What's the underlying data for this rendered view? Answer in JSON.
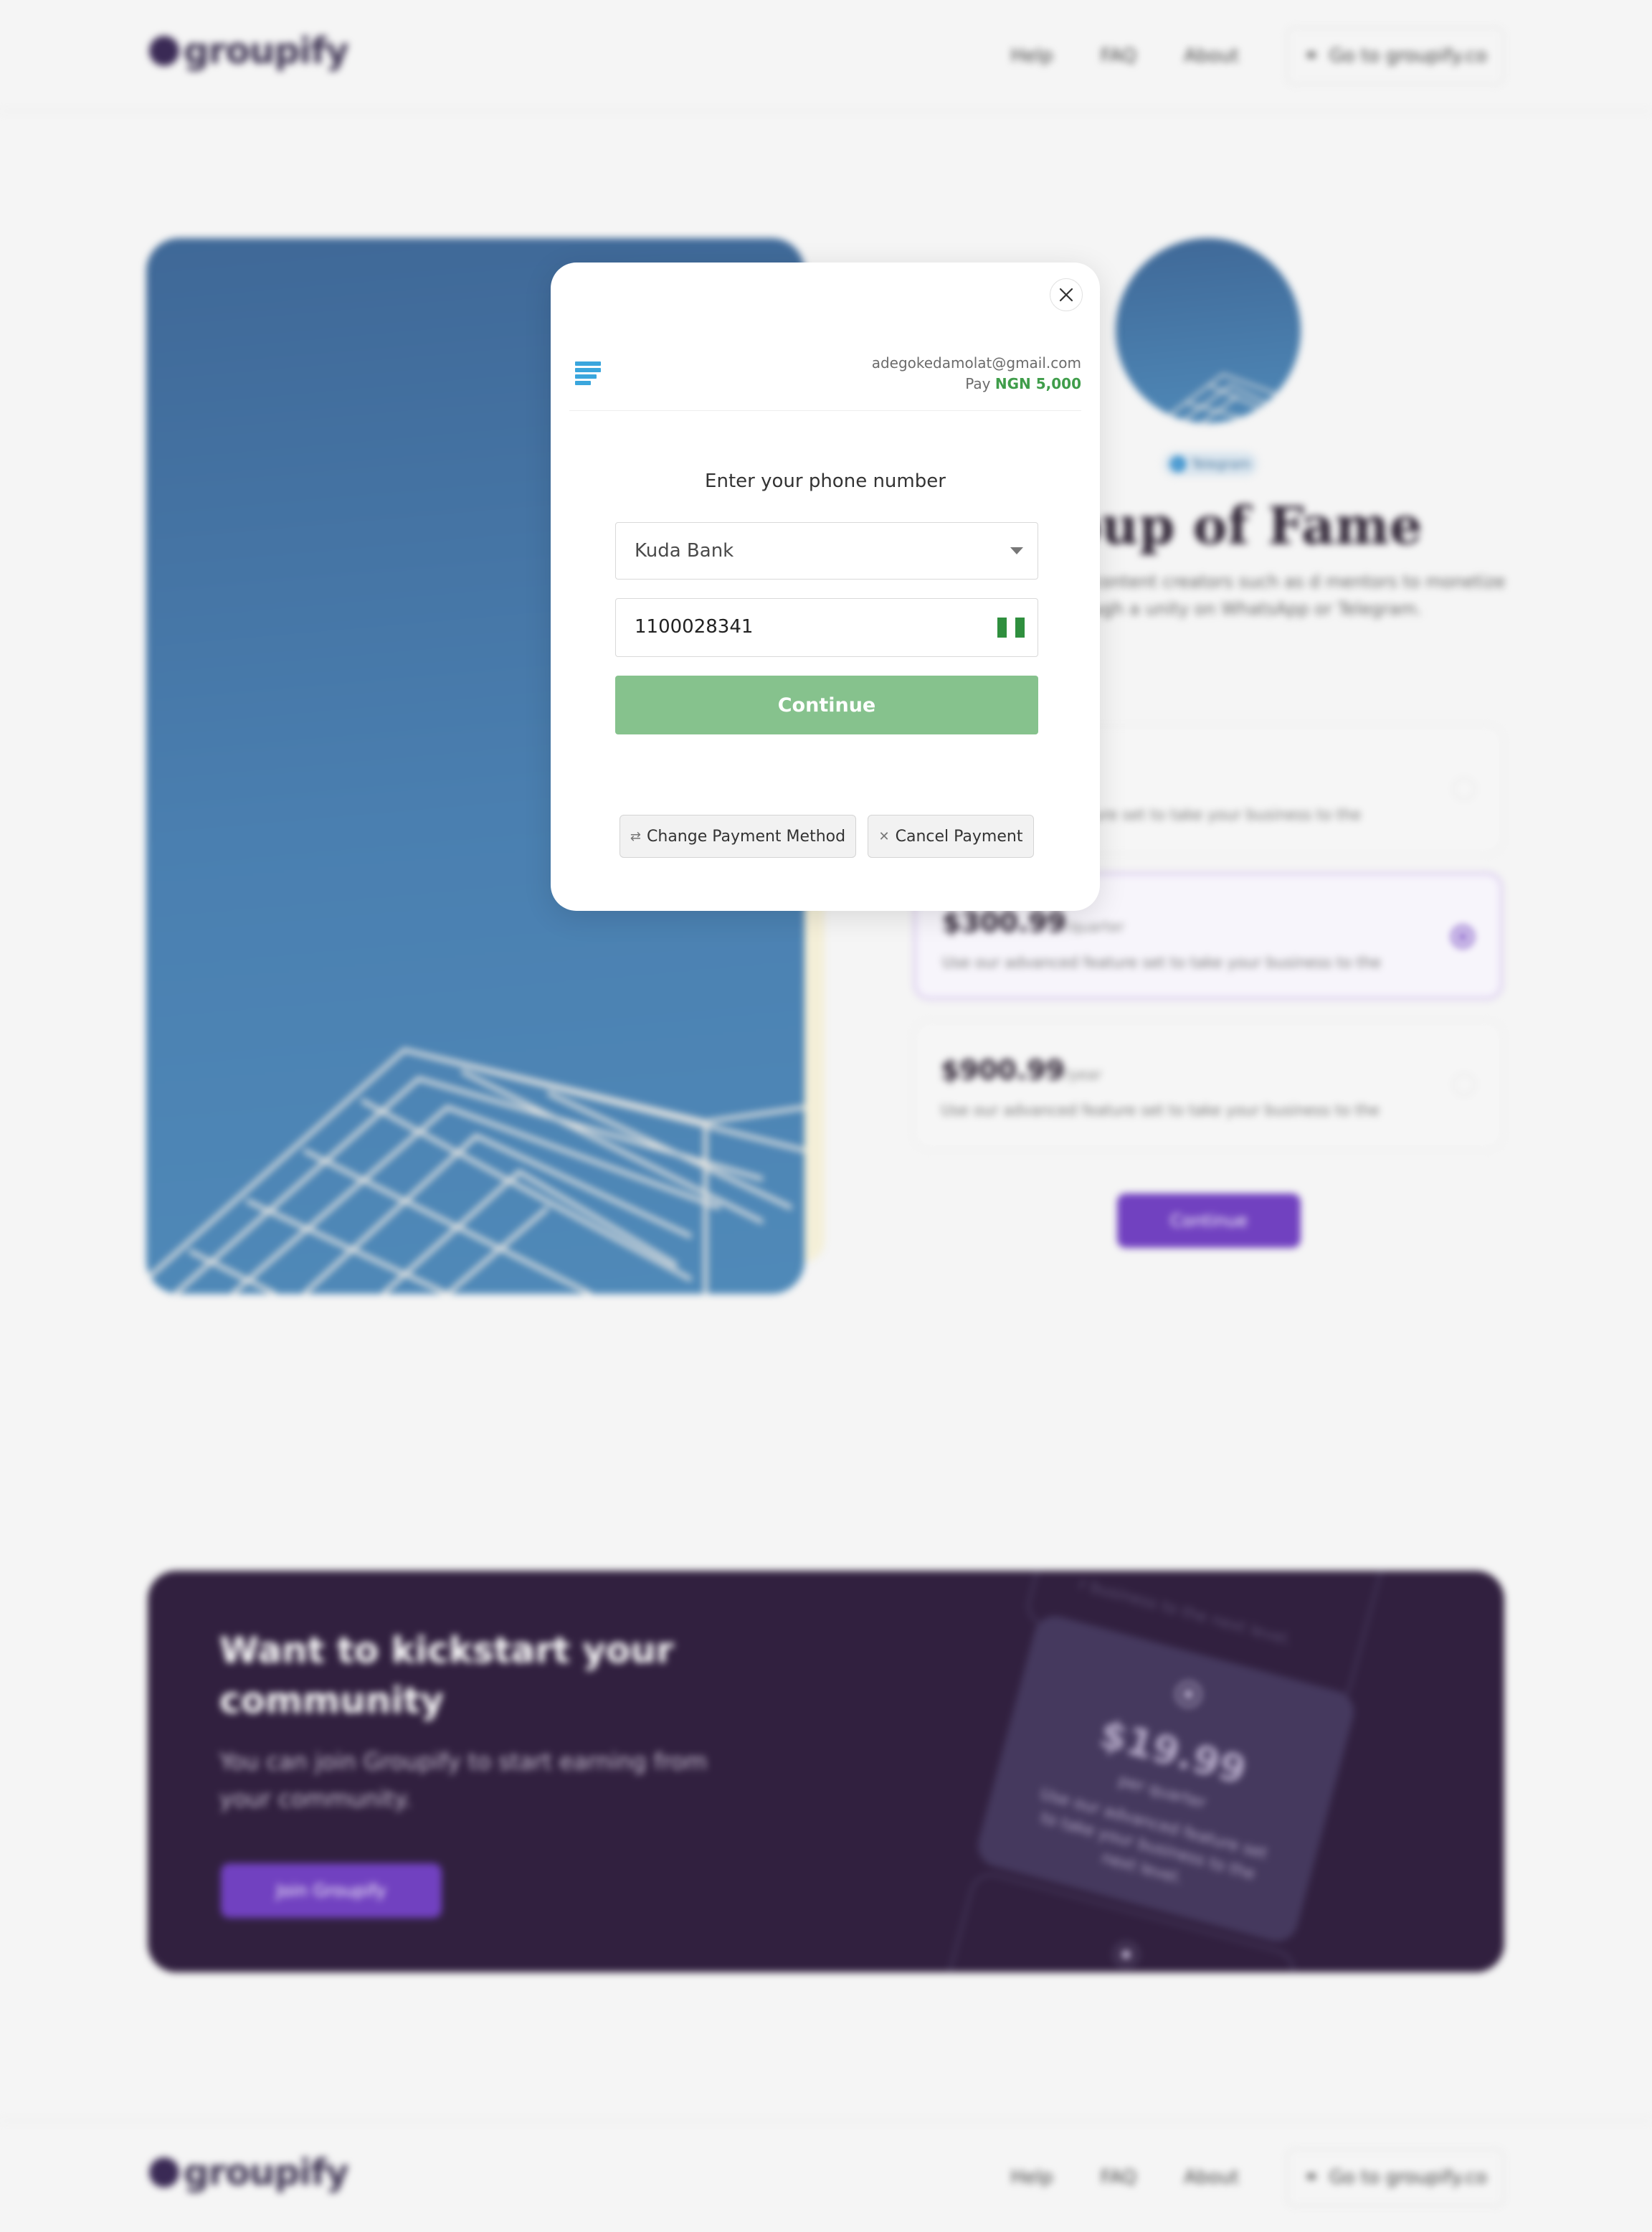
{
  "header": {
    "logo_text": "groupify",
    "nav": [
      "Help",
      "FAQ",
      "About"
    ],
    "cta_label": "Go to groupify.co"
  },
  "community": {
    "badge": "Telegram",
    "title": "Group of Fame",
    "description": "tform that allows content creators such as d mentors to monetize their content through a unity on WhatsApp or Telegram."
  },
  "plans": [
    {
      "price": "",
      "period": "",
      "description": "ture set to take your business to the",
      "selected": false
    },
    {
      "price": "$300.99",
      "period": "/quarter",
      "description": "Use our advanced feature set to take your business to the",
      "selected": true
    },
    {
      "price": "$900.99",
      "period": "/year",
      "description": "Use our advanced feature set to take your business to the",
      "selected": false
    }
  ],
  "bg_continue_label": "Continue",
  "cta_banner": {
    "title": "Want to kickstart your community",
    "subtitle": "You can join Groupify to start earning from your community.",
    "button_label": "Join Groupify",
    "card_top_text": "r business to the next level.",
    "card_price": "$19.99",
    "card_period": "per quarter",
    "card_desc": "Use our advanced feature set to take your business to the next level."
  },
  "footer": {
    "logo_text": "groupify",
    "nav": [
      "Help",
      "FAQ",
      "About"
    ],
    "cta_label": "Go to groupify.co"
  },
  "payment_modal": {
    "email": "adegokedamolat@gmail.com",
    "pay_label": "Pay",
    "amount": "NGN 5,000",
    "heading": "Enter your phone number",
    "bank_selected": "Kuda Bank",
    "phone_value": "1100028341",
    "continue_label": "Continue",
    "change_method_label": "Change Payment Method",
    "cancel_label": "Cancel Payment"
  },
  "colors": {
    "brand_purple": "#7141c0",
    "pay_green": "#3f9d4a",
    "continue_green": "#86c28d",
    "banner_bg": "#31203f"
  }
}
